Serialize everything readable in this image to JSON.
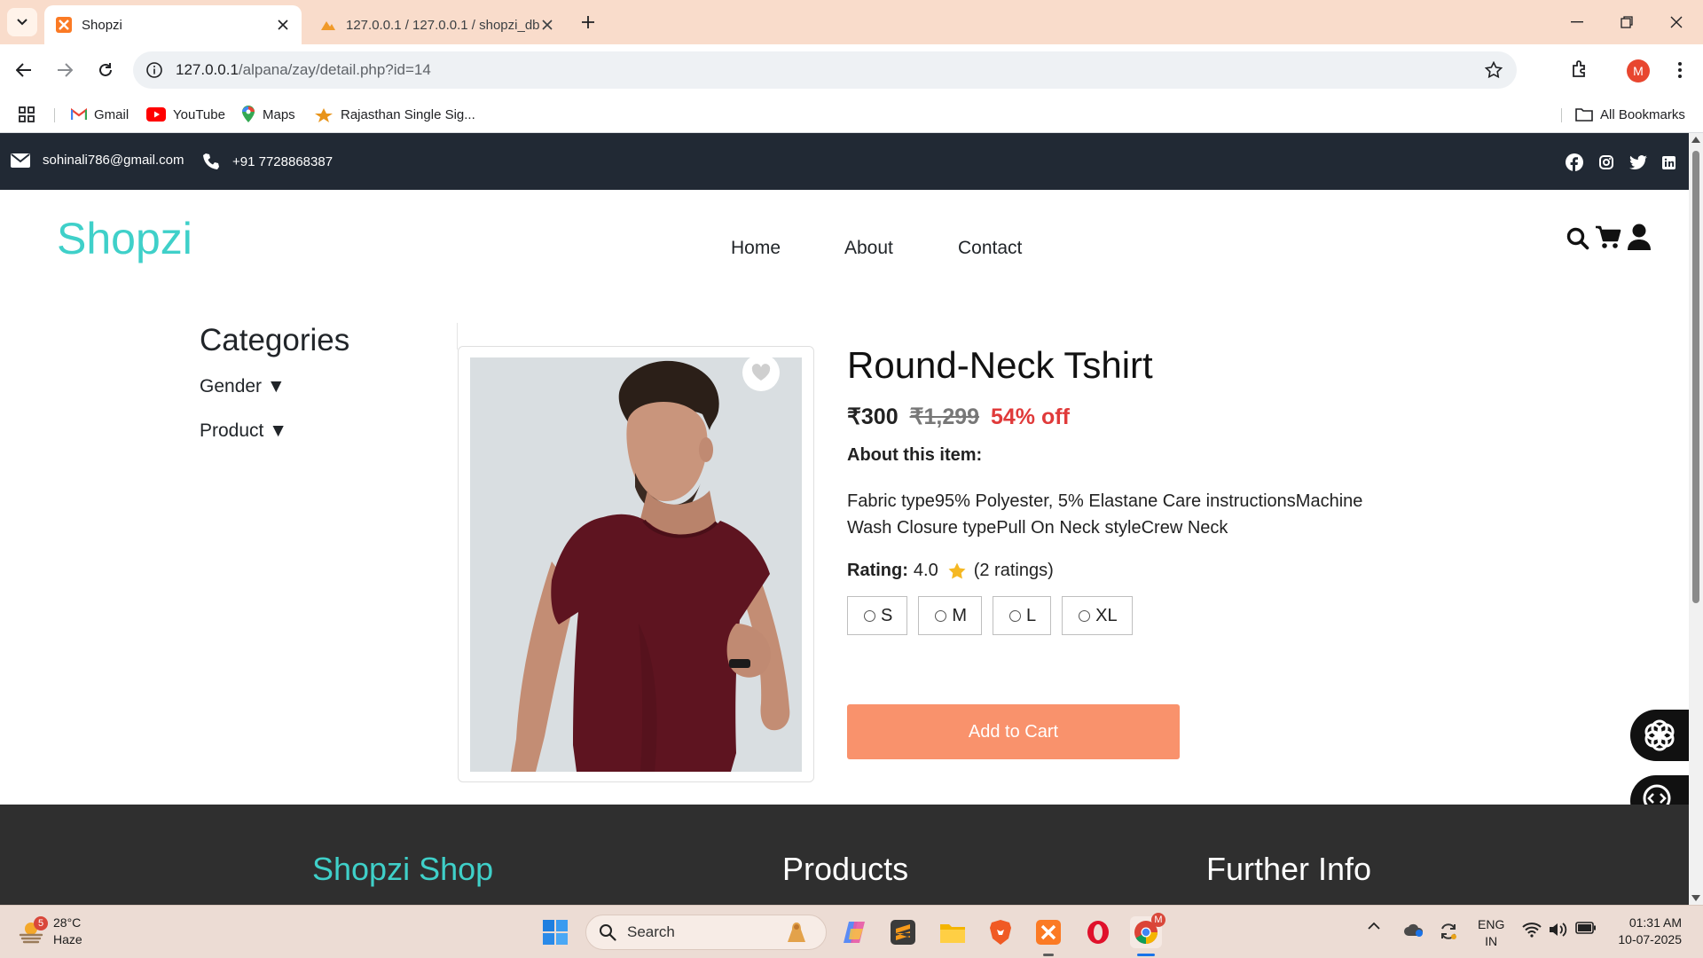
{
  "browser": {
    "tabs": [
      {
        "title": "Shopzi",
        "active": true
      },
      {
        "title": "127.0.0.1 / 127.0.0.1 / shopzi_db",
        "active": false
      }
    ],
    "url_host": "127.0.0.1",
    "url_path": "/alpana/zay/detail.php?id=14",
    "profile_initial": "M",
    "bookmarks": [
      "Gmail",
      "YouTube",
      "Maps",
      "Rajasthan Single Sig..."
    ],
    "all_bookmarks": "All Bookmarks"
  },
  "topbar": {
    "email": "sohinali786@gmail.com",
    "phone": "+91 7728868387",
    "socials": [
      "facebook-icon",
      "instagram-icon",
      "twitter-icon",
      "linkedin-icon"
    ]
  },
  "header": {
    "logo": "Shopzi",
    "nav": [
      "Home",
      "About",
      "Contact"
    ]
  },
  "sidebar": {
    "title": "Categories",
    "items": [
      "Gender ▼",
      "Product ▼"
    ]
  },
  "product": {
    "title": "Round-Neck Tshirt",
    "price": "₹300",
    "mrp": "₹1,299",
    "discount": "54% off",
    "about_label": "About this item:",
    "description": "Fabric type95% Polyester, 5% Elastane Care instructionsMachine Wash Closure typePull On Neck styleCrew Neck",
    "rating_label": "Rating:",
    "rating_value": "4.0",
    "rating_count": "(2 ratings)",
    "sizes": [
      "S",
      "M",
      "L",
      "XL"
    ],
    "add_to_cart": "Add to Cart",
    "shirt_color": "#5e1420"
  },
  "footer": {
    "columns": [
      "Shopzi Shop",
      "Products",
      "Further Info"
    ]
  },
  "taskbar": {
    "temperature": "28°C",
    "condition": "Haze",
    "weather_badge": "5",
    "search": "Search",
    "lang_line1": "ENG",
    "lang_line2": "IN",
    "time": "01:31 AM",
    "date": "10-07-2025"
  },
  "colors": {
    "accent": "#3fd0c9",
    "cta": "#f9926c",
    "discount": "#e03a3a",
    "topbar": "#212934",
    "footer": "#2f2f2f"
  }
}
